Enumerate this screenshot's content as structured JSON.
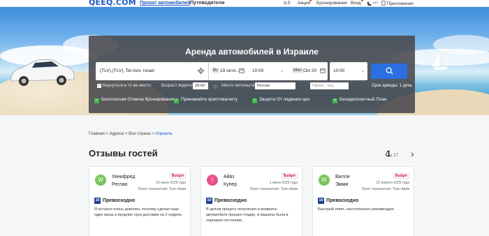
{
  "header": {
    "logo": "QEEQ.COM",
    "nav_car": "Прокат автомобилей",
    "nav_drivers": "Путеводители",
    "currency": "ILS",
    "deals": "Акции",
    "bookings": "Бронирования",
    "login": "Вход",
    "support": "24/7",
    "app": "Приложение"
  },
  "search": {
    "title": "Аренда автомобилей в Израиле",
    "location": "(TLV),(TLV), Tel Aviv, Israel",
    "pickup_day": "Вс",
    "pickup_date": "19 октя...",
    "pickup_time": "10:00",
    "return_day": "Mon",
    "return_date": "Oct 20",
    "return_time": "10:00",
    "return_same": "Вернуться в то же место",
    "driver_age_label": "Возраст водителя:",
    "driver_age": "30-60",
    "residence_label": "Место жительства:",
    "residence": "Россия",
    "promo_placeholder": "Промо - код",
    "rental_period": "Срок аренды: 1 день"
  },
  "benefits": [
    "Бесплатная Отмена бронирования",
    "Принимайте криптовалюту",
    "Защита От падения цен",
    "Безадепозитный План"
  ],
  "breadcrumb": {
    "home": "Главная",
    "sep": ">",
    "addresses": "Адреса",
    "countries": "Все страны",
    "current": "Израиль"
  },
  "reviews": {
    "title": "Отзывы гостей",
    "page_current": "1",
    "page_total": "/ 17",
    "items": [
      {
        "initial": "W",
        "avatar_color": "#7cc35b",
        "first": "Уинифред",
        "last": "Реглан",
        "brand": "Budget",
        "date": "16 июня 2025 года",
        "dest": "Пункт назначения: Тель-Авив",
        "score": "10",
        "rating": "Превосходно",
        "text": "Я остался очень доволен, поэтому сделал еще один заказ и продлил срок доставки на 2 недели."
      },
      {
        "initial": "I",
        "avatar_color": "#e8508a",
        "first": "Айвз",
        "last": "Купер",
        "brand": "Budget",
        "date": "1 июня 2025 года",
        "dest": "Пункт назначения: Тель-Авив",
        "score": "10",
        "rating": "Превосходно",
        "text": "В целом процесс получения и возврата автомобиля прошел гладко, и машина была в хорошем состоянии."
      },
      {
        "initial": "W",
        "avatar_color": "#7cc35b",
        "first": "Вилли",
        "last": "Эмми",
        "brand": "Budget",
        "date": "22 апреля 2025 года",
        "dest": "Пункт назначения: Тель-Авив",
        "score": "10",
        "rating": "Превосходно",
        "text": "Быстрый ответ, настоятельно рекомендую."
      }
    ]
  },
  "icons": [
    "locate-icon",
    "calendar-icon",
    "search-icon",
    "phone-icon",
    "app-icon",
    "chevron-left-icon",
    "chevron-right-icon"
  ]
}
